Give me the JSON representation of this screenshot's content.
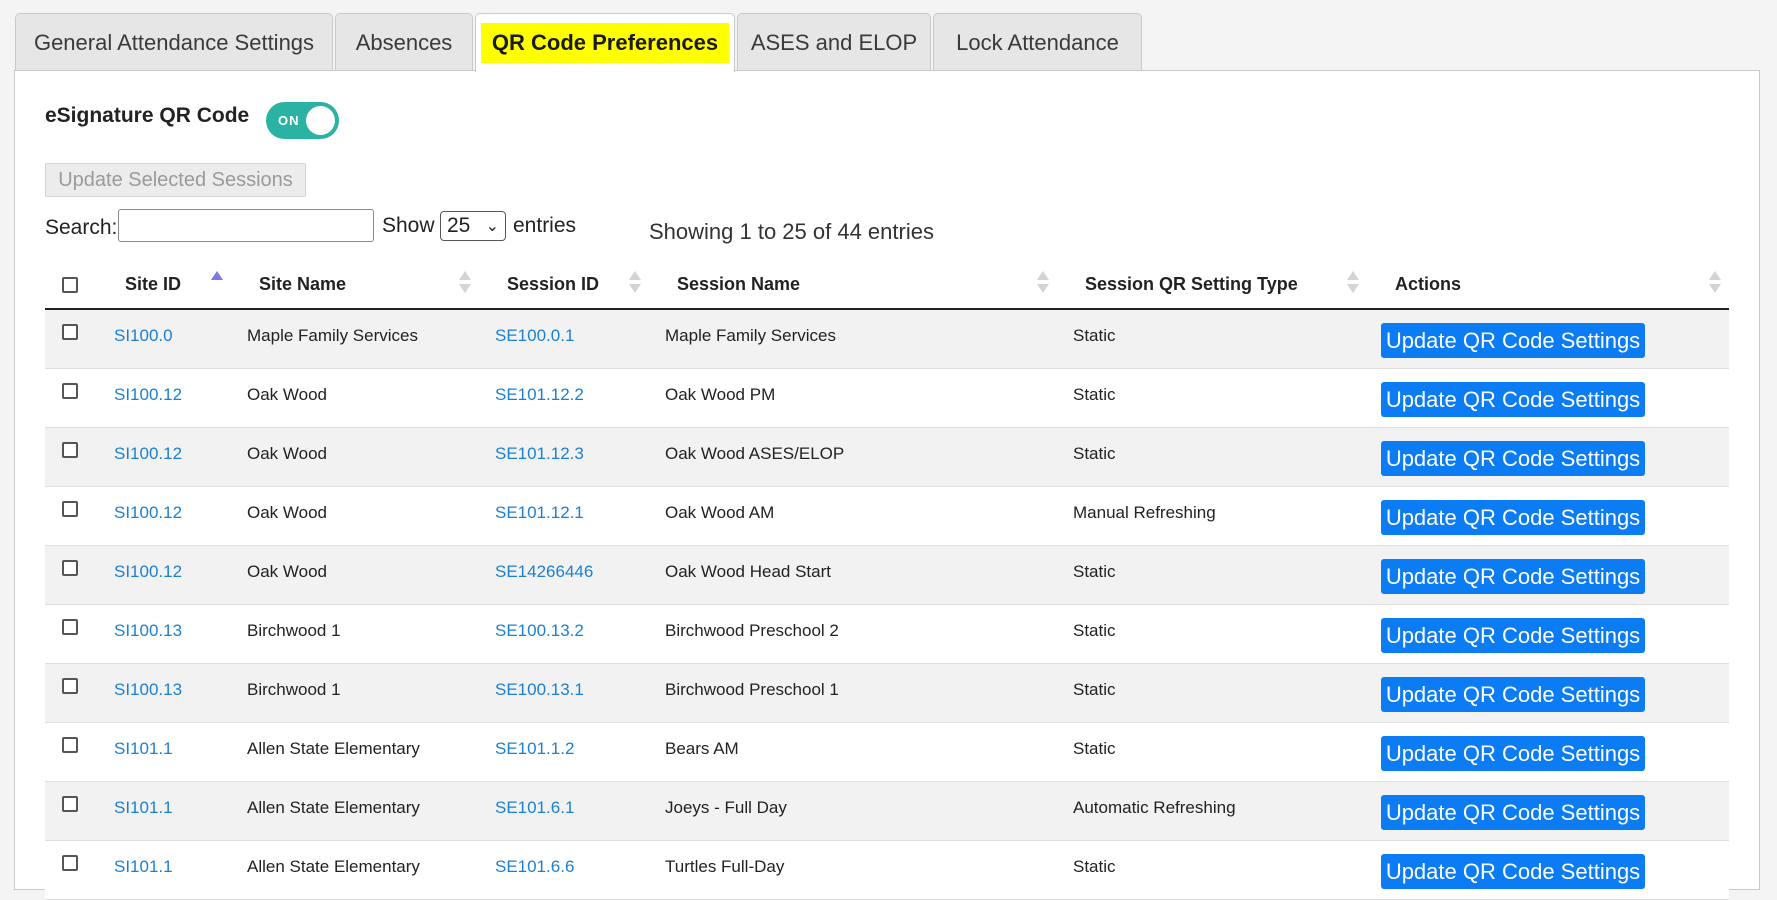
{
  "tabs": [
    {
      "label": "General Attendance Settings",
      "active": false
    },
    {
      "label": "Absences",
      "active": false
    },
    {
      "label": "QR Code Preferences",
      "active": true
    },
    {
      "label": "ASES and ELOP",
      "active": false
    },
    {
      "label": "Lock Attendance",
      "active": false
    }
  ],
  "esignature": {
    "label": "eSignature QR Code",
    "toggle_label": "ON",
    "enabled": true
  },
  "update_selected_label": "Update Selected Sessions",
  "search": {
    "label": "Search:",
    "value": ""
  },
  "show": {
    "label": "Show",
    "value": "25",
    "suffix": "entries"
  },
  "info": "Showing 1 to 25 of 44 entries",
  "table": {
    "columns": [
      "Site ID",
      "Site Name",
      "Session ID",
      "Session Name",
      "Session QR Setting Type",
      "Actions"
    ],
    "sort_column": "Site ID",
    "sort_direction": "ascending",
    "action_label": "Update QR Code Settings",
    "rows": [
      {
        "site_id": "SI100.0",
        "site_name": "Maple Family Services",
        "session_id": "SE100.0.1",
        "session_name": "Maple Family Services",
        "qr_type": "Static"
      },
      {
        "site_id": "SI100.12",
        "site_name": "Oak Wood",
        "session_id": "SE101.12.2",
        "session_name": "Oak Wood PM",
        "qr_type": "Static"
      },
      {
        "site_id": "SI100.12",
        "site_name": "Oak Wood",
        "session_id": "SE101.12.3",
        "session_name": "Oak Wood ASES/ELOP",
        "qr_type": "Static"
      },
      {
        "site_id": "SI100.12",
        "site_name": "Oak Wood",
        "session_id": "SE101.12.1",
        "session_name": "Oak Wood AM",
        "qr_type": "Manual Refreshing"
      },
      {
        "site_id": "SI100.12",
        "site_name": "Oak Wood",
        "session_id": "SE14266446",
        "session_name": "Oak Wood Head Start",
        "qr_type": "Static"
      },
      {
        "site_id": "SI100.13",
        "site_name": "Birchwood 1",
        "session_id": "SE100.13.2",
        "session_name": "Birchwood Preschool 2",
        "qr_type": "Static"
      },
      {
        "site_id": "SI100.13",
        "site_name": "Birchwood 1",
        "session_id": "SE100.13.1",
        "session_name": "Birchwood Preschool 1",
        "qr_type": "Static"
      },
      {
        "site_id": "SI101.1",
        "site_name": "Allen State Elementary",
        "session_id": "SE101.1.2",
        "session_name": "Bears AM",
        "qr_type": "Static"
      },
      {
        "site_id": "SI101.1",
        "site_name": "Allen State Elementary",
        "session_id": "SE101.6.1",
        "session_name": "Joeys - Full Day",
        "qr_type": "Automatic Refreshing"
      },
      {
        "site_id": "SI101.1",
        "site_name": "Allen State Elementary",
        "session_id": "SE101.6.6",
        "session_name": "Turtles Full-Day",
        "qr_type": "Static"
      }
    ]
  }
}
